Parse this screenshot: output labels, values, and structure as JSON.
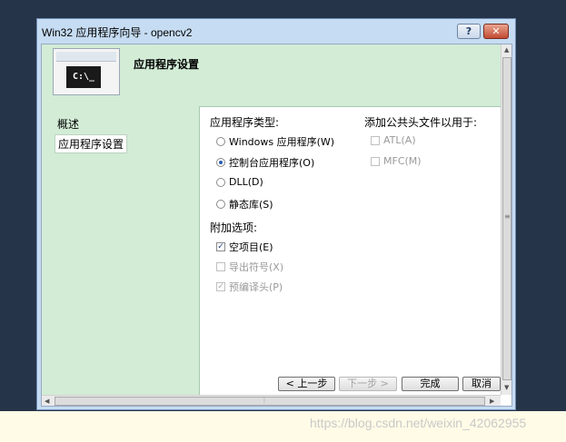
{
  "window": {
    "title": "Win32 应用程序向导 - opencv2",
    "help_label": "?",
    "close_label": "✕"
  },
  "header": {
    "title": "应用程序设置",
    "thumbnail_text": "C:\\_"
  },
  "nav": {
    "items": [
      {
        "label": "概述",
        "selected": false
      },
      {
        "label": "应用程序设置",
        "selected": true
      }
    ]
  },
  "app_type": {
    "label": "应用程序类型:",
    "options": [
      {
        "label": "Windows 应用程序(W)",
        "selected": false
      },
      {
        "label": "控制台应用程序(O)",
        "selected": true
      },
      {
        "label": "DLL(D)",
        "selected": false
      },
      {
        "label": "静态库(S)",
        "selected": false
      }
    ]
  },
  "common_headers": {
    "label": "添加公共头文件以用于:",
    "options": [
      {
        "label": "ATL(A)",
        "checked": false,
        "enabled": false
      },
      {
        "label": "MFC(M)",
        "checked": false,
        "enabled": false
      }
    ]
  },
  "additional": {
    "label": "附加选项:",
    "options": [
      {
        "label": "空项目(E)",
        "checked": true,
        "enabled": true
      },
      {
        "label": "导出符号(X)",
        "checked": false,
        "enabled": false
      },
      {
        "label": "预编译头(P)",
        "checked": true,
        "enabled": false
      }
    ]
  },
  "buttons": {
    "prev": "< 上一步",
    "next": "下一步 >",
    "finish": "完成",
    "cancel": "取消"
  },
  "watermark": "https://blog.csdn.net/weixin_42062955"
}
